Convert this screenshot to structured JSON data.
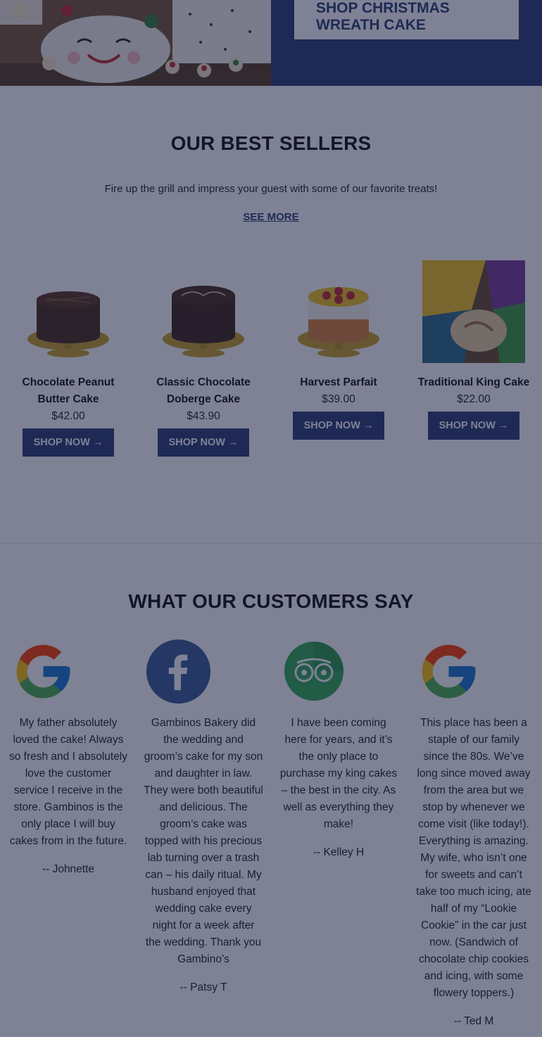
{
  "hero": {
    "cta_line1": "SHOP CHRISTMAS",
    "cta_line2": "WREATH CAKE"
  },
  "best_sellers": {
    "title": "OUR BEST SELLERS",
    "subtitle": "Fire up the grill and impress your guest with some of our favorite treats!",
    "see_more": "SEE MORE",
    "products": [
      {
        "name": "Chocolate Peanut Butter Cake",
        "price": "$42.00",
        "button": "SHOP NOW →"
      },
      {
        "name": "Classic Chocolate Doberge Cake",
        "price": "$43.90",
        "button": "SHOP NOW →"
      },
      {
        "name": "Harvest Parfait",
        "price": "$39.00",
        "button": "SHOP NOW →"
      },
      {
        "name": "Traditional King Cake",
        "price": "$22.00",
        "button": "SHOP NOW →"
      }
    ]
  },
  "reviews": {
    "title": "WHAT OUR CUSTOMERS SAY",
    "items": [
      {
        "source_icon": "google-icon",
        "text": "My father absolutely loved the cake! Always so fresh and I absolutely love the customer service I receive in the store. Gambinos is the only place I will buy cakes from in the future.",
        "author": "-- Johnette"
      },
      {
        "source_icon": "facebook-icon",
        "text": "Gambinos Bakery did the wedding and groom’s cake for my son and daughter in law. They were both beautiful and delicious. The groom’s cake was topped with his precious lab turning over a trash can – his daily ritual. My husband enjoyed that wedding cake every night for a week after the wedding. Thank you Gambino’s",
        "author": "-- Patsy T"
      },
      {
        "source_icon": "tripadvisor-icon",
        "text": "I have been coming here for years, and it’s the only place to purchase my king cakes – the best in the city. As well as everything they make!",
        "author": "-- Kelley H"
      },
      {
        "source_icon": "google-icon",
        "text": "This place has been a staple of our family since the 80s. We’ve long since moved away from the area but we stop by whenever we come visit (like today!). Everything is amazing. My wife, who isn’t one for sweets and can’t take too much icing, ate half of my “Lookie Cookie” in the car just now. (Sandwich of chocolate chip cookies and icing, with some flowery toppers.)",
        "author": "-- Ted M"
      }
    ]
  },
  "colors": {
    "brand_navy": "#2c3a74",
    "overlay": "#141c3c"
  }
}
